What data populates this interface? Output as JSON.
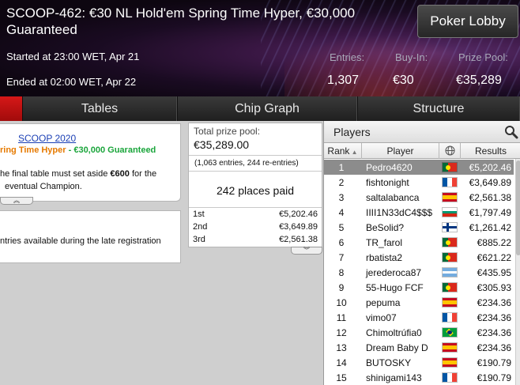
{
  "header": {
    "title": "SCOOP-462: €30 NL Hold'em Spring Time Hyper, €30,000 Guaranteed",
    "started": "Started at 23:00 WET, Apr 21",
    "ended": "Ended at 02:00 WET, Apr 22",
    "entries_label": "Entries:",
    "entries_value": "1,307",
    "buyin_label": "Buy-In:",
    "buyin_value": "€30",
    "prizepool_label": "Prize Pool:",
    "prizepool_value": "€35,289",
    "lobby_button": "Poker Lobby"
  },
  "tabs": [
    {
      "label": "Tables"
    },
    {
      "label": "Chip Graph"
    },
    {
      "label": "Structure"
    }
  ],
  "info": {
    "link": "SCOOP 2020",
    "promo_orange": "ring Time Hyper",
    "promo_sep": " - ",
    "promo_green": "€30,000 Guaranteed",
    "rule_pre": "he final table must set aside ",
    "rule_bold": "€600",
    "rule_post": " for the",
    "rule_line2": "eventual Champion.",
    "late_reg": "ntries available during the late registration"
  },
  "prizes": {
    "total_label": "Total prize pool:",
    "total_value": "€35,289.00",
    "entries_note": "(1,063 entries, 244 re-entries)",
    "places_paid": "242 places paid",
    "rows": [
      {
        "place": "1st",
        "amount": "€5,202.46"
      },
      {
        "place": "2nd",
        "amount": "€3,649.89"
      },
      {
        "place": "3rd",
        "amount": "€2,561.38"
      }
    ]
  },
  "players": {
    "title": "Players",
    "columns": {
      "rank": "Rank",
      "player": "Player",
      "results": "Results"
    },
    "rows": [
      {
        "rank": "1",
        "name": "Pedro4620",
        "flag": "portugal",
        "result": "€5,202.46"
      },
      {
        "rank": "2",
        "name": "fishtonight",
        "flag": "france",
        "result": "€3,649.89"
      },
      {
        "rank": "3",
        "name": "saltalabanca",
        "flag": "spain",
        "result": "€2,561.38"
      },
      {
        "rank": "4",
        "name": "IIII1N33dC4$$$",
        "flag": "bulgaria",
        "result": "€1,797.49"
      },
      {
        "rank": "5",
        "name": "BeSolid?",
        "flag": "finland",
        "result": "€1,261.42"
      },
      {
        "rank": "6",
        "name": "TR_farol",
        "flag": "portugal",
        "result": "€885.22"
      },
      {
        "rank": "7",
        "name": "rbatista2",
        "flag": "portugal",
        "result": "€621.22"
      },
      {
        "rank": "8",
        "name": "jerederoca87",
        "flag": "argentina",
        "result": "€435.95"
      },
      {
        "rank": "9",
        "name": "55-Hugo FCF",
        "flag": "portugal",
        "result": "€305.93"
      },
      {
        "rank": "10",
        "name": "pepuma",
        "flag": "spain",
        "result": "€234.36"
      },
      {
        "rank": "11",
        "name": "vimo07",
        "flag": "france",
        "result": "€234.36"
      },
      {
        "rank": "12",
        "name": "Chimoltrúfia0",
        "flag": "brazil",
        "result": "€234.36"
      },
      {
        "rank": "13",
        "name": "Dream Baby D",
        "flag": "spain",
        "result": "€234.36"
      },
      {
        "rank": "14",
        "name": "BUTOSKY",
        "flag": "spain",
        "result": "€190.79"
      },
      {
        "rank": "15",
        "name": "shinigami143",
        "flag": "france",
        "result": "€190.79"
      }
    ]
  },
  "colors": {
    "accent_red": "#c41212",
    "promo_orange": "#e67a00",
    "promo_green": "#1aa53b",
    "link_blue": "#1b3fb5"
  }
}
